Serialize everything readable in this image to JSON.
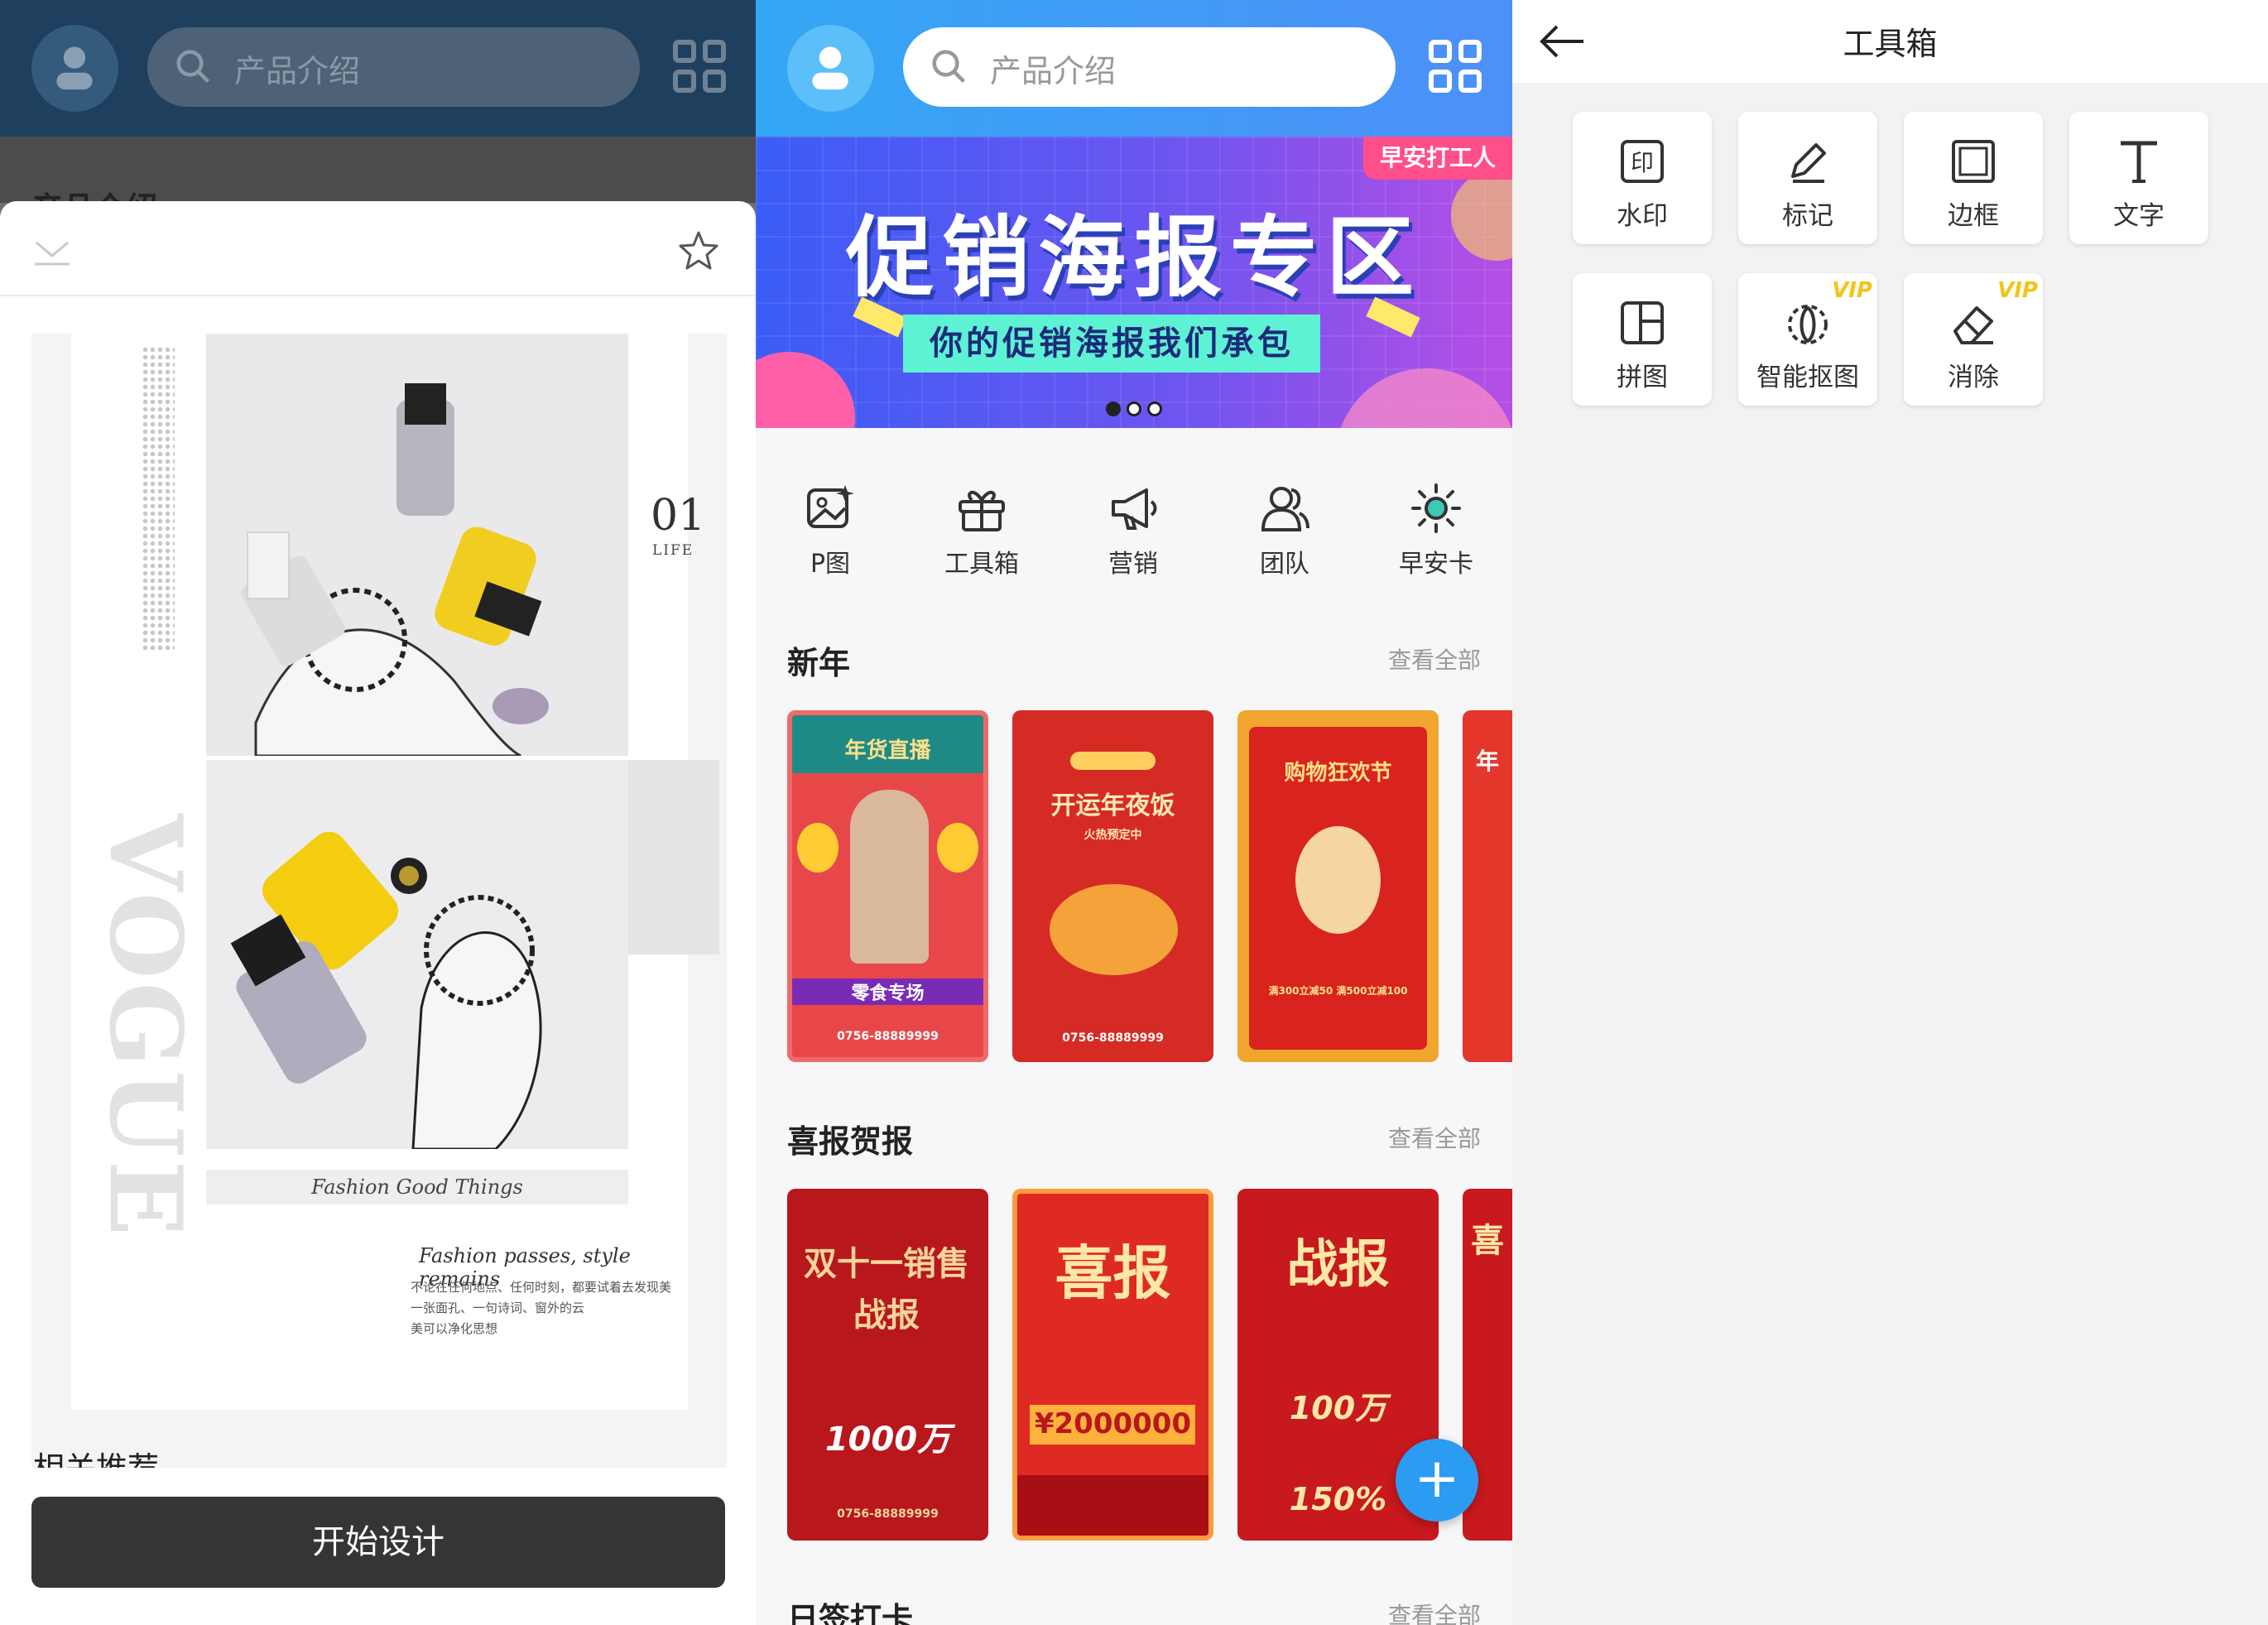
{
  "panel1": {
    "search_placeholder": "产品介绍",
    "peek_text": "产品介绍",
    "poster": {
      "number": "01",
      "number_sub": "LIFE",
      "vertical_word": "VOGUE",
      "caption": "Fashion Good Things",
      "tagline": "Fashion passes, style remains",
      "body_lines": [
        "不论在任何地点、任何时刻，都要试着去发现美",
        "一张面孔、一句诗词、窗外的云",
        "美可以净化思想"
      ]
    },
    "related_label": "相关推荐",
    "start_button": "开始设计"
  },
  "panel2": {
    "search_placeholder": "产品介绍",
    "banner": {
      "tag": "早安打工人",
      "title": "促销海报专区",
      "subtitle": "你的促销海报我们承包",
      "page_count": 3,
      "active_page": 1
    },
    "quick_actions": [
      {
        "label": "P图",
        "icon": "image-edit-icon"
      },
      {
        "label": "工具箱",
        "icon": "gift-box-icon"
      },
      {
        "label": "营销",
        "icon": "megaphone-icon"
      },
      {
        "label": "团队",
        "icon": "team-icon"
      },
      {
        "label": "早安卡",
        "icon": "sun-icon"
      }
    ],
    "sections": [
      {
        "title": "新年",
        "more": "查看全部",
        "cards": [
          {
            "heading": "年货直播",
            "sub": "零食专场",
            "phone": "0756-88889999"
          },
          {
            "heading": "开运年夜饭",
            "sub": "火热预定中",
            "phone": "0756-88889999"
          },
          {
            "heading": "购物狂欢节",
            "sub": "满300立减50  满500立减100",
            "phone": ""
          },
          {
            "heading": "年",
            "sub": "",
            "phone": ""
          }
        ]
      },
      {
        "title": "喜报贺报",
        "more": "查看全部",
        "cards": [
          {
            "heading": "双十一销售战报",
            "sub": "1000万",
            "phone": "0756-88889999"
          },
          {
            "heading": "喜报",
            "sub": "¥2000000",
            "phone": ""
          },
          {
            "heading": "战报",
            "sub": "100万  150%",
            "phone": ""
          },
          {
            "heading": "喜",
            "sub": "",
            "phone": ""
          }
        ]
      },
      {
        "title": "日签打卡",
        "more": "查看全部",
        "cards": []
      }
    ],
    "fab_label": "+",
    "colors": {
      "brand_blue": "#34a7f3",
      "poster_red": "#d7262a"
    }
  },
  "panel3": {
    "title": "工具箱",
    "tools": [
      {
        "label": "水印",
        "icon": "watermark-icon",
        "vip": ""
      },
      {
        "label": "标记",
        "icon": "pen-mark-icon",
        "vip": ""
      },
      {
        "label": "边框",
        "icon": "frame-border-icon",
        "vip": ""
      },
      {
        "label": "文字",
        "icon": "text-t-icon",
        "vip": ""
      },
      {
        "label": "拼图",
        "icon": "collage-icon",
        "vip": ""
      },
      {
        "label": "智能抠图",
        "icon": "smart-cutout-icon",
        "vip": "VIP"
      },
      {
        "label": "消除",
        "icon": "eraser-icon",
        "vip": "VIP"
      }
    ]
  }
}
